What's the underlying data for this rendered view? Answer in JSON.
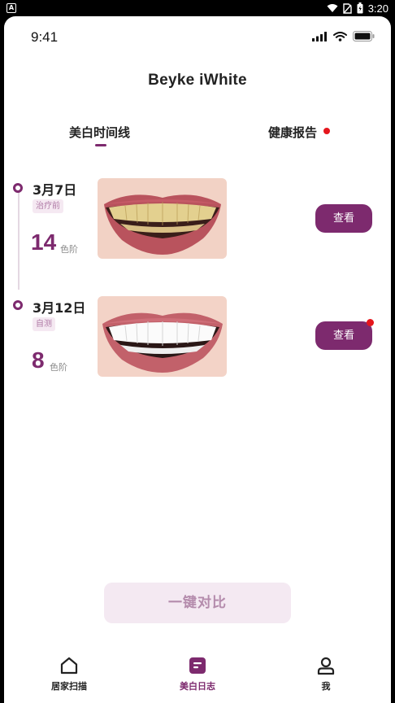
{
  "system_bar": {
    "time": "3:20",
    "app_icon": "A"
  },
  "status_bar": {
    "time": "9:41"
  },
  "header": {
    "title": "Beyke iWhite"
  },
  "tabs": [
    {
      "label": "美白时间线",
      "active": true
    },
    {
      "label": "健康报告",
      "has_notification": true
    }
  ],
  "timeline": [
    {
      "date": "3月7日",
      "tag": "治疗前",
      "score": "14",
      "unit": "色阶",
      "button": "查看",
      "image": "teeth-before-photo",
      "has_notification": false
    },
    {
      "date": "3月12日",
      "tag": "自测",
      "score": "8",
      "unit": "色阶",
      "button": "查看",
      "image": "teeth-after-photo",
      "has_notification": true
    }
  ],
  "compare_button": "一键对比",
  "bottom_nav": [
    {
      "label": "居家扫描",
      "icon": "home-icon"
    },
    {
      "label": "美白日志",
      "icon": "journal-icon",
      "active": true
    },
    {
      "label": "我",
      "icon": "profile-icon"
    }
  ],
  "colors": {
    "accent": "#7d2a6e",
    "accent_light": "#f4e9f2",
    "notification": "#e5161d"
  }
}
